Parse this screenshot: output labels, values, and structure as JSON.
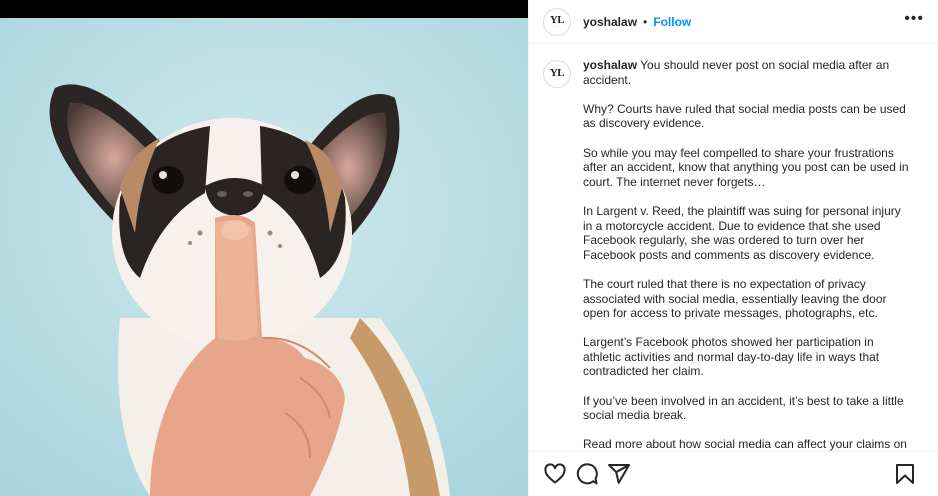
{
  "post": {
    "username": "yoshalaw",
    "separator": "•",
    "follow_label": "Follow",
    "more_label": "•••",
    "avatar_monogram": "YL",
    "caption_paragraphs": [
      "You should never post on social media after an accident.",
      "Why? Courts have ruled that social media posts can be used as discovery evidence.",
      "So while you may feel compelled to share your frustrations after an accident, know that anything you post can be used in court. The internet never forgets…",
      "In Largent v. Reed, the plaintiff was suing for personal injury in a motorcycle accident. Due to evidence that she used Facebook regularly, she was ordered to turn over her Facebook posts and comments as discovery evidence.",
      "The court ruled that there is no expectation of privacy associated with social media, essentially leaving the door open for access to private messages, photographs, etc.",
      "Largent’s Facebook photos showed her participation in athletic activities and normal day-to-day life in ways that contradicted her claim.",
      "If you’ve been involved in an accident, it’s best to take a little social media break.",
      "Read more about how social media can affect your claims on"
    ]
  },
  "actions": {
    "icons": [
      "heart-icon",
      "comment-icon",
      "share-icon",
      "bookmark-icon"
    ]
  },
  "colors": {
    "accent": "#0095f6",
    "text": "#262626",
    "photo_background": "#bfe0e6"
  }
}
